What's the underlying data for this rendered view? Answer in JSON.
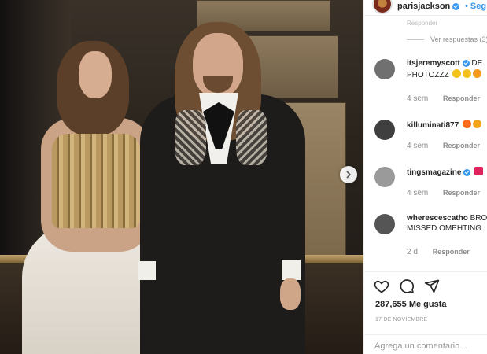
{
  "post": {
    "username": "parisjackson",
    "follow_label": "• Seg"
  },
  "comments_top": {
    "reply_label": "Responder",
    "view_replies": "Ver respuestas (3)"
  },
  "comments": [
    {
      "user": "itsjeremyscott",
      "text": "DE",
      "text2": "PHOTOZZZ",
      "time": "4 sem",
      "reply": "Responder",
      "avatar_color": "#7a7a7a"
    },
    {
      "user": "killuminati877",
      "text": "",
      "text2": "",
      "time": "4 sem",
      "reply": "Responder",
      "avatar_color": "#4d4d4d"
    },
    {
      "user": "tingsmagazine",
      "text": "",
      "text2": "",
      "time": "4 sem",
      "reply": "Responder",
      "avatar_color": "#8c8c8c"
    },
    {
      "user": "wherescescatho",
      "text": "BRO",
      "text2": "MISSED OMEHTING",
      "time": "2 d",
      "reply": "Responder",
      "avatar_color": "#5a5a5a"
    }
  ],
  "likes": "287,655 Me gusta",
  "date": "17 DE NOVIEMBRE",
  "comment_box": {
    "placeholder": "Agrega un comentario..."
  },
  "colors": {
    "accent": "#3897f0",
    "muted": "#8e8e8e",
    "border": "#efefef"
  },
  "icons": [
    "verified-badge-icon",
    "chevron-right-icon",
    "heart-icon",
    "comment-icon",
    "share-icon"
  ]
}
